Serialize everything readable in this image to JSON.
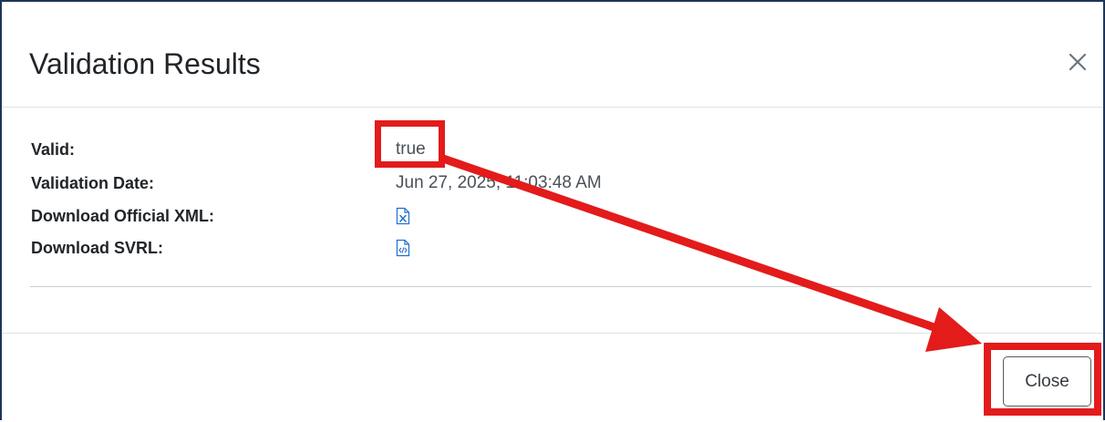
{
  "dialog": {
    "title": "Validation Results",
    "close_icon": "close-icon",
    "fields": [
      {
        "label": "Valid:",
        "value": "true"
      },
      {
        "label": "Validation Date:",
        "value": "Jun 27, 2025, 11:03:48 AM"
      },
      {
        "label": "Download Official XML:",
        "icon": "xml-file-icon"
      },
      {
        "label": "Download SVRL:",
        "icon": "code-file-icon"
      }
    ],
    "close_label": "Close"
  },
  "colors": {
    "annotation": "#e31b1b",
    "link_icon": "#1f6fd1",
    "frame": "#1d3557"
  }
}
